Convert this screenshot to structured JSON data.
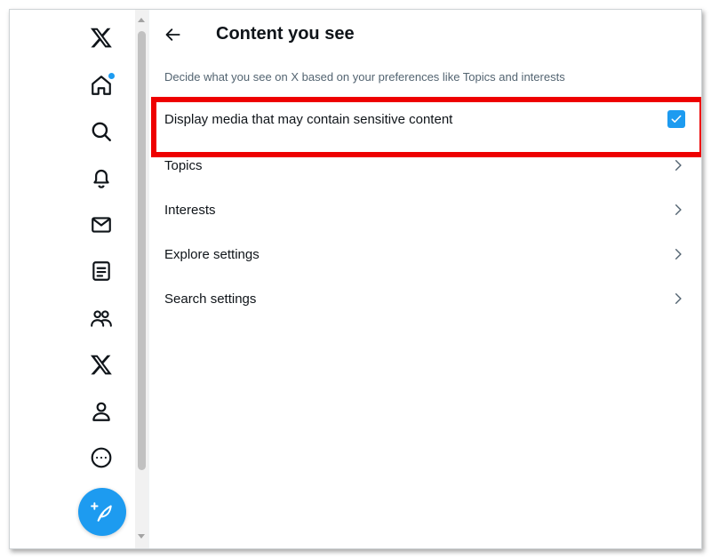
{
  "header": {
    "title": "Content you see",
    "description": "Decide what you see on X based on your preferences like Topics and interests"
  },
  "settings": {
    "sensitive_media": {
      "label": "Display media that may contain sensitive content",
      "checked": true
    },
    "items": [
      {
        "label": "Topics"
      },
      {
        "label": "Interests"
      },
      {
        "label": "Explore settings"
      },
      {
        "label": "Search settings"
      }
    ]
  },
  "nav": {
    "icons": [
      "x-logo-icon",
      "home-icon",
      "search-icon",
      "bell-icon",
      "mail-icon",
      "lists-icon",
      "communities-icon",
      "premium-x-icon",
      "profile-icon",
      "more-icon"
    ],
    "compose_icon": "compose-feather-icon",
    "notification_dot": true
  },
  "colors": {
    "accent": "#1d9bf0",
    "highlight": "#ee0000",
    "secondary_text": "#536471"
  }
}
